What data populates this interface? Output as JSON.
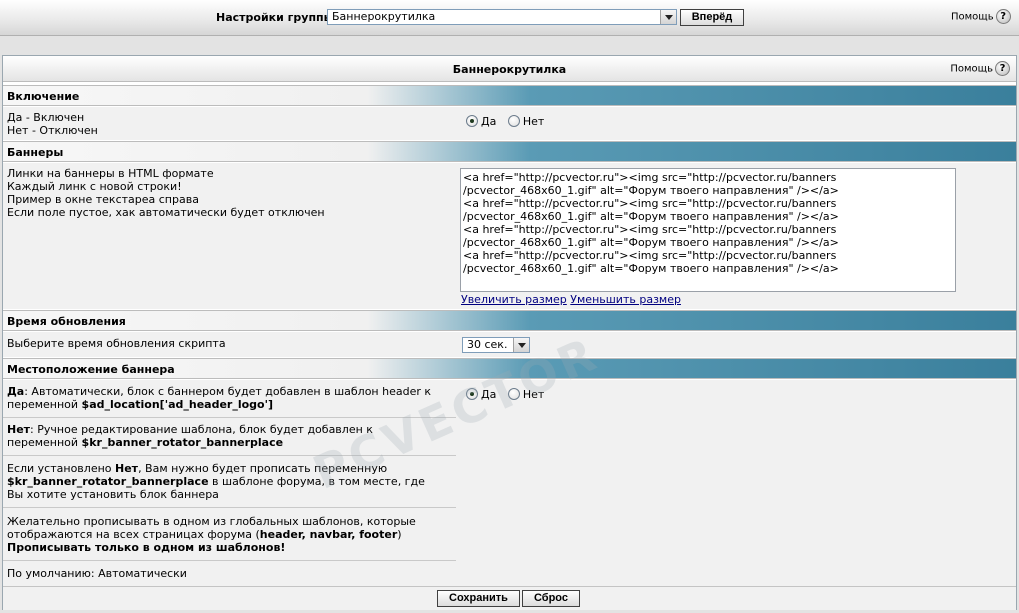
{
  "topbar": {
    "group_label": "Настройки группы",
    "group_select_value": "Баннерокрутилка",
    "go_button": "Вперёд",
    "help_label": "Помощь",
    "help_icon_text": "?"
  },
  "panel": {
    "title": "Баннерокрутилка",
    "help_label": "Помощь",
    "help_icon_text": "?"
  },
  "sections": {
    "enable": {
      "title": "Включение",
      "desc": [
        "Да - Включен",
        "Нет - Отключен"
      ],
      "yes": "Да",
      "no": "Нет",
      "selected": "yes"
    },
    "banners": {
      "title": "Баннеры",
      "desc": [
        "Линки на баннеры в HTML формате",
        "Каждый линк с новой строки!",
        "Пример в окне текстареа справа",
        "Если поле пустое, хак автоматически будет отключен"
      ],
      "textarea_lines": [
        "<a href=\"http://pcvector.ru\"><img src=\"http://pcvector.ru/banners",
        "/pcvector_468x60_1.gif\" alt=\"Форум твоего направления\" /></a>",
        "<a href=\"http://pcvector.ru\"><img src=\"http://pcvector.ru/banners",
        "/pcvector_468x60_1.gif\" alt=\"Форум твоего направления\" /></a>",
        "<a href=\"http://pcvector.ru\"><img src=\"http://pcvector.ru/banners",
        "/pcvector_468x60_1.gif\" alt=\"Форум твоего направления\" /></a>",
        "<a href=\"http://pcvector.ru\"><img src=\"http://pcvector.ru/banners",
        "/pcvector_468x60_1.gif\" alt=\"Форум твоего направления\" /></a>"
      ],
      "increase_link": "Увеличить размер",
      "decrease_link": "Уменьшить размер"
    },
    "refresh": {
      "title": "Время обновления",
      "desc": "Выберите время обновления скрипта",
      "select_value": "30 сек."
    },
    "location": {
      "title": "Местоположение баннера",
      "yes": "Да",
      "no": "Нет",
      "selected": "yes",
      "p1_bold": "Да",
      "p1_text": ": Автоматически, блок с баннером будет добавлен в шаблон header к",
      "p1_text2": "переменной ",
      "p1_var": "$ad_location['ad_header_logo']",
      "p2_bold": "Нет",
      "p2_text": ": Ручное редактирование шаблона, блок будет добавлен к",
      "p2_text2": "переменной ",
      "p2_var": "$kr_banner_rotator_bannerplace",
      "p3_text": "Если установлено ",
      "p3_bold": "Нет",
      "p3_text2": ", Вам нужно будет прописать переменную",
      "p3_var": "$kr_banner_rotator_bannerplace",
      "p3_text3": " в шаблоне форума, в том месте, где",
      "p3_text4": "Вы хотите установить блок баннера",
      "p4_text": "Желательно прописывать в одном из глобальных шаблонов, которые",
      "p4_text2": "отображаются на всех страницах форума (",
      "p4_bold": "header, navbar, footer",
      "p4_text3": ")",
      "p4_bold2": "Прописывать только в одном из шаблонов!",
      "p5_text": "По умолчанию: Автоматически"
    }
  },
  "footer": {
    "save_button": "Сохранить",
    "reset_button": "Сброс"
  },
  "watermark": "PCVECTOR"
}
